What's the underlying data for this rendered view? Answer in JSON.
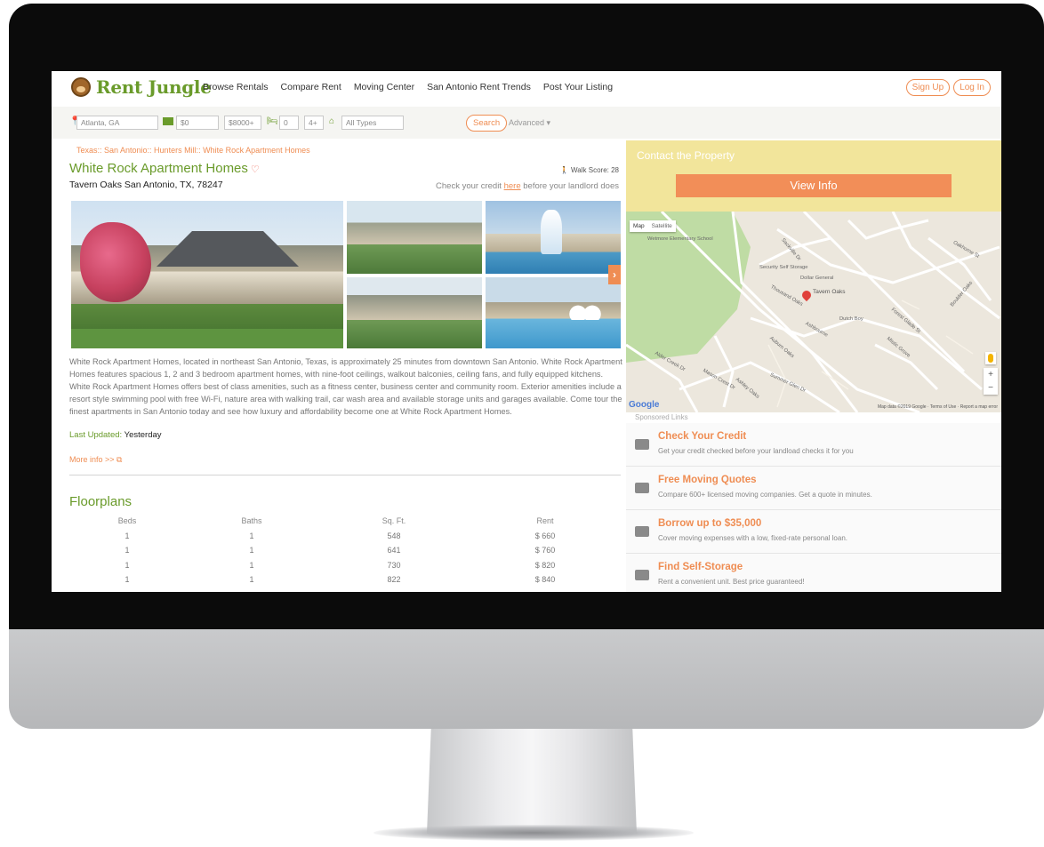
{
  "nav": {
    "logo": "Rent Jungle",
    "links": [
      "Browse Rentals",
      "Compare Rent",
      "Moving Center",
      "San Antonio Rent Trends",
      "Post Your Listing"
    ],
    "signup": "Sign Up",
    "login": "Log In"
  },
  "filters": {
    "location": "Atlanta, GA",
    "price_min": "$0",
    "price_max": "$8000+",
    "beds_min": "0",
    "beds_max": "4+",
    "type": "All Types",
    "search": "Search",
    "advanced": "Advanced ▾"
  },
  "property": {
    "breadcrumb": "Texas:: San Antonio:: Hunters Mill:: White Rock Apartment Homes",
    "name": "White Rock Apartment Homes",
    "address": "Tavern Oaks San Antonio, TX, 78247",
    "walk_score": "Walk Score: 28",
    "credit_pre": "Check your credit ",
    "credit_link": "here",
    "credit_post": " before your landlord does",
    "description": "White Rock Apartment Homes, located in northeast San Antonio, Texas, is approximately 25 minutes from downtown San Antonio. White Rock Apartment Homes features spacious 1, 2 and 3 bedroom apartment homes, with nine-foot ceilings, walkout balconies, ceiling fans, and fully equipped kitchens. White Rock Apartment Homes offers best of class amenities, such as a fitness center, business center and community room. Exterior amenities include a resort style swimming pool with free Wi-Fi, nature area with walking trail, car wash area and available storage units and garages available. Come tour the finest apartments in San Antonio today and see how luxury and affordability become one at White Rock Apartment Homes.",
    "last_updated_label": "Last Updated:",
    "last_updated_value": "Yesterday",
    "more_info": "More info >>"
  },
  "floorplans": {
    "title": "Floorplans",
    "headers": [
      "Beds",
      "Baths",
      "Sq. Ft.",
      "Rent"
    ],
    "rows": [
      [
        "1",
        "1",
        "548",
        "$ 660"
      ],
      [
        "1",
        "1",
        "641",
        "$ 760"
      ],
      [
        "1",
        "1",
        "730",
        "$ 820"
      ],
      [
        "1",
        "1",
        "822",
        "$ 840"
      ]
    ]
  },
  "contact": {
    "title": "Contact the Property",
    "button": "View Info"
  },
  "map": {
    "tab_map": "Map",
    "tab_satellite": "Satellite",
    "pin_label": "Tavern Oaks",
    "google": "Google",
    "credit": "Map data ©2019 Google · Terms of Use · Report a map error",
    "labels": [
      "Wetmore Elementary School",
      "Security Self Storage",
      "Dollar General",
      "Dutch Boy",
      "Thousand Oaks",
      "Ashbourne",
      "Auburn Oaks",
      "Summer Glen Dr",
      "Mason Crest Dr",
      "Alder Creek Dr",
      "Sackville Dr",
      "Oakhorne St",
      "Boulder Oaks",
      "Forest Glade St",
      "Mistic Grove",
      "Ashley Oaks"
    ]
  },
  "sponsored": {
    "label": "Sponsored Links",
    "ads": [
      {
        "title": "Check Your Credit",
        "subtitle": "Get your credit checked before your landload checks it for you",
        "icon": "credit-card-icon"
      },
      {
        "title": "Free Moving Quotes",
        "subtitle": "Compare 600+ licensed moving companies. Get a quote in minutes.",
        "icon": "box-icon"
      },
      {
        "title": "Borrow up to $35,000",
        "subtitle": "Cover moving expenses with a low, fixed-rate personal loan.",
        "icon": "wallet-icon"
      },
      {
        "title": "Find Self-Storage",
        "subtitle": "Rent a convenient unit. Best price guaranteed!",
        "icon": "storage-icon"
      }
    ]
  },
  "colors": {
    "brand_green": "#6a9b2b",
    "accent_orange": "#ef8d53",
    "contact_yellow": "#f2e59b"
  }
}
